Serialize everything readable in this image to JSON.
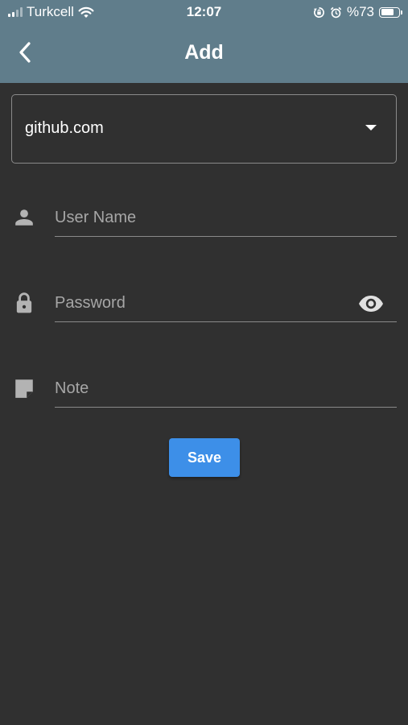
{
  "status_bar": {
    "carrier": "Turkcell",
    "time": "12:07",
    "battery": "%73",
    "battery_level": 0.73
  },
  "header": {
    "title": "Add",
    "back_icon": "chevron-left-icon"
  },
  "site_select": {
    "value": "github.com",
    "icon": "arrow-drop-down-icon"
  },
  "form": {
    "username": {
      "placeholder": "User Name",
      "value": "",
      "icon": "person-icon"
    },
    "password": {
      "placeholder": "Password",
      "value": "",
      "icon": "lock-icon",
      "toggle_icon": "eye-icon"
    },
    "note": {
      "placeholder": "Note",
      "value": "",
      "icon": "note-icon"
    }
  },
  "actions": {
    "save_label": "Save"
  },
  "colors": {
    "app_bar": "#607d8b",
    "background": "#303030",
    "accent_button": "#3d8fe8",
    "field_line": "#8a8a8a",
    "placeholder": "#a6a6a6"
  }
}
